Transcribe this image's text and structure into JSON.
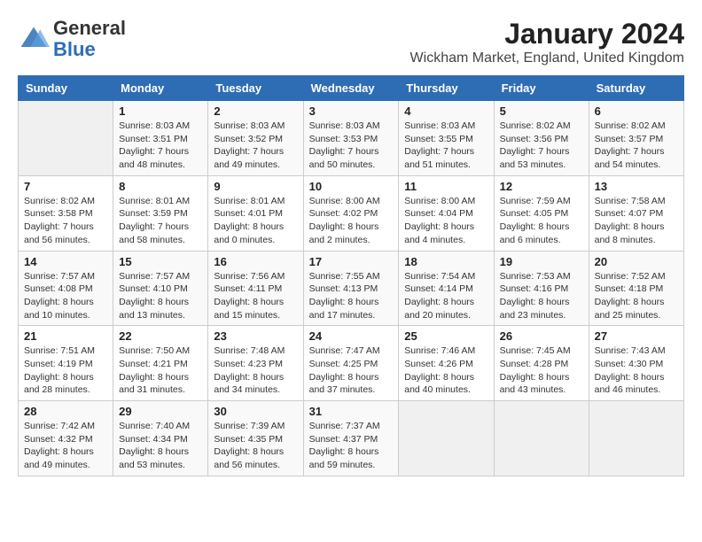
{
  "header": {
    "logo_line1": "General",
    "logo_line2": "Blue",
    "title": "January 2024",
    "subtitle": "Wickham Market, England, United Kingdom"
  },
  "days_of_week": [
    "Sunday",
    "Monday",
    "Tuesday",
    "Wednesday",
    "Thursday",
    "Friday",
    "Saturday"
  ],
  "weeks": [
    [
      {
        "day": "",
        "info": ""
      },
      {
        "day": "1",
        "info": "Sunrise: 8:03 AM\nSunset: 3:51 PM\nDaylight: 7 hours and 48 minutes."
      },
      {
        "day": "2",
        "info": "Sunrise: 8:03 AM\nSunset: 3:52 PM\nDaylight: 7 hours and 49 minutes."
      },
      {
        "day": "3",
        "info": "Sunrise: 8:03 AM\nSunset: 3:53 PM\nDaylight: 7 hours and 50 minutes."
      },
      {
        "day": "4",
        "info": "Sunrise: 8:03 AM\nSunset: 3:55 PM\nDaylight: 7 hours and 51 minutes."
      },
      {
        "day": "5",
        "info": "Sunrise: 8:02 AM\nSunset: 3:56 PM\nDaylight: 7 hours and 53 minutes."
      },
      {
        "day": "6",
        "info": "Sunrise: 8:02 AM\nSunset: 3:57 PM\nDaylight: 7 hours and 54 minutes."
      }
    ],
    [
      {
        "day": "7",
        "info": "Sunrise: 8:02 AM\nSunset: 3:58 PM\nDaylight: 7 hours and 56 minutes."
      },
      {
        "day": "8",
        "info": "Sunrise: 8:01 AM\nSunset: 3:59 PM\nDaylight: 7 hours and 58 minutes."
      },
      {
        "day": "9",
        "info": "Sunrise: 8:01 AM\nSunset: 4:01 PM\nDaylight: 8 hours and 0 minutes."
      },
      {
        "day": "10",
        "info": "Sunrise: 8:00 AM\nSunset: 4:02 PM\nDaylight: 8 hours and 2 minutes."
      },
      {
        "day": "11",
        "info": "Sunrise: 8:00 AM\nSunset: 4:04 PM\nDaylight: 8 hours and 4 minutes."
      },
      {
        "day": "12",
        "info": "Sunrise: 7:59 AM\nSunset: 4:05 PM\nDaylight: 8 hours and 6 minutes."
      },
      {
        "day": "13",
        "info": "Sunrise: 7:58 AM\nSunset: 4:07 PM\nDaylight: 8 hours and 8 minutes."
      }
    ],
    [
      {
        "day": "14",
        "info": "Sunrise: 7:57 AM\nSunset: 4:08 PM\nDaylight: 8 hours and 10 minutes."
      },
      {
        "day": "15",
        "info": "Sunrise: 7:57 AM\nSunset: 4:10 PM\nDaylight: 8 hours and 13 minutes."
      },
      {
        "day": "16",
        "info": "Sunrise: 7:56 AM\nSunset: 4:11 PM\nDaylight: 8 hours and 15 minutes."
      },
      {
        "day": "17",
        "info": "Sunrise: 7:55 AM\nSunset: 4:13 PM\nDaylight: 8 hours and 17 minutes."
      },
      {
        "day": "18",
        "info": "Sunrise: 7:54 AM\nSunset: 4:14 PM\nDaylight: 8 hours and 20 minutes."
      },
      {
        "day": "19",
        "info": "Sunrise: 7:53 AM\nSunset: 4:16 PM\nDaylight: 8 hours and 23 minutes."
      },
      {
        "day": "20",
        "info": "Sunrise: 7:52 AM\nSunset: 4:18 PM\nDaylight: 8 hours and 25 minutes."
      }
    ],
    [
      {
        "day": "21",
        "info": "Sunrise: 7:51 AM\nSunset: 4:19 PM\nDaylight: 8 hours and 28 minutes."
      },
      {
        "day": "22",
        "info": "Sunrise: 7:50 AM\nSunset: 4:21 PM\nDaylight: 8 hours and 31 minutes."
      },
      {
        "day": "23",
        "info": "Sunrise: 7:48 AM\nSunset: 4:23 PM\nDaylight: 8 hours and 34 minutes."
      },
      {
        "day": "24",
        "info": "Sunrise: 7:47 AM\nSunset: 4:25 PM\nDaylight: 8 hours and 37 minutes."
      },
      {
        "day": "25",
        "info": "Sunrise: 7:46 AM\nSunset: 4:26 PM\nDaylight: 8 hours and 40 minutes."
      },
      {
        "day": "26",
        "info": "Sunrise: 7:45 AM\nSunset: 4:28 PM\nDaylight: 8 hours and 43 minutes."
      },
      {
        "day": "27",
        "info": "Sunrise: 7:43 AM\nSunset: 4:30 PM\nDaylight: 8 hours and 46 minutes."
      }
    ],
    [
      {
        "day": "28",
        "info": "Sunrise: 7:42 AM\nSunset: 4:32 PM\nDaylight: 8 hours and 49 minutes."
      },
      {
        "day": "29",
        "info": "Sunrise: 7:40 AM\nSunset: 4:34 PM\nDaylight: 8 hours and 53 minutes."
      },
      {
        "day": "30",
        "info": "Sunrise: 7:39 AM\nSunset: 4:35 PM\nDaylight: 8 hours and 56 minutes."
      },
      {
        "day": "31",
        "info": "Sunrise: 7:37 AM\nSunset: 4:37 PM\nDaylight: 8 hours and 59 minutes."
      },
      {
        "day": "",
        "info": ""
      },
      {
        "day": "",
        "info": ""
      },
      {
        "day": "",
        "info": ""
      }
    ]
  ]
}
